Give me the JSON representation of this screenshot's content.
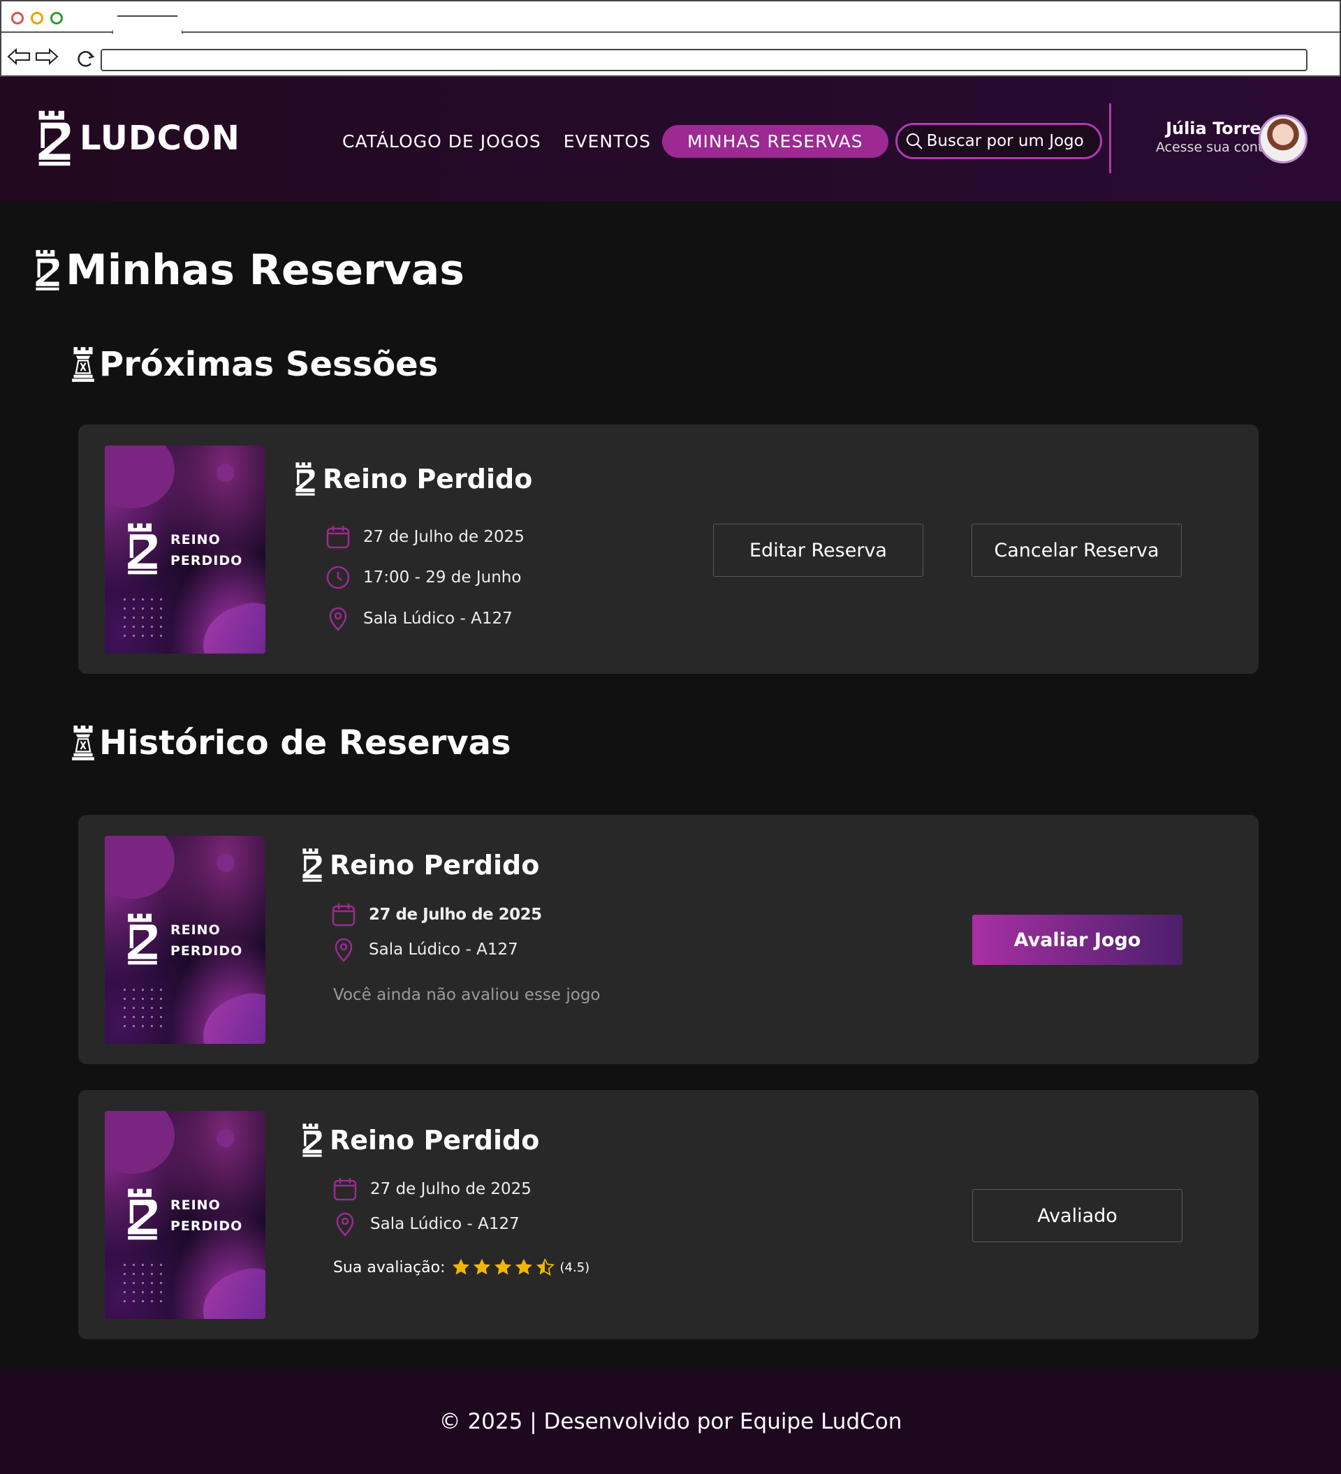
{
  "header": {
    "logo_text": "LUDCON",
    "nav": {
      "catalog": "CATÁLOGO DE JOGOS",
      "events": "EVENTOS",
      "reservations": "MINHAS RESERVAS"
    },
    "search_placeholder": "Buscar por um Jogo",
    "account_name": "Júlia Torres",
    "account_sub": "Acesse sua conta"
  },
  "page": {
    "title": "Minhas Reservas"
  },
  "upcoming": {
    "title": "Próximas Sessões",
    "card": {
      "cover_line1": "REINO",
      "cover_line2": "PERDIDO",
      "game": "Reino Perdido",
      "date": "27 de Julho de 2025",
      "time": "17:00 - 29 de Junho",
      "room": "Sala Lúdico - A127",
      "edit_label": "Editar Reserva",
      "cancel_label": "Cancelar Reserva"
    }
  },
  "history": {
    "title": "Histórico de Reservas",
    "cards": [
      {
        "cover_line1": "REINO",
        "cover_line2": "PERDIDO",
        "game": "Reino Perdido",
        "date": "27 de Julho de 2025",
        "room": "Sala Lúdico - A127",
        "note": "Você ainda não avaliou esse jogo",
        "action_label": "Avaliar Jogo"
      },
      {
        "cover_line1": "REINO",
        "cover_line2": "PERDIDO",
        "game": "Reino Perdido",
        "date": "27 de Julho de 2025",
        "room": "Sala Lúdico - A127",
        "rating_label": "Sua avaliação:",
        "rating": 4.5,
        "rating_text": "(4.5)",
        "action_label": "Avaliado"
      }
    ]
  },
  "footer": {
    "text": "© 2025 | Desenvolvido por Equipe LudCon"
  },
  "colors": {
    "accent": "#9c2a92",
    "header_bg": "#22091f",
    "card_bg": "#282828",
    "page_bg": "#111111",
    "star": "#f2b705"
  },
  "icons": {
    "logo": "ludcon-rook-icon",
    "section": "chess-rook-icon",
    "date": "calendar-icon",
    "time": "clock-icon",
    "room": "map-pin-icon",
    "search": "search-icon"
  }
}
